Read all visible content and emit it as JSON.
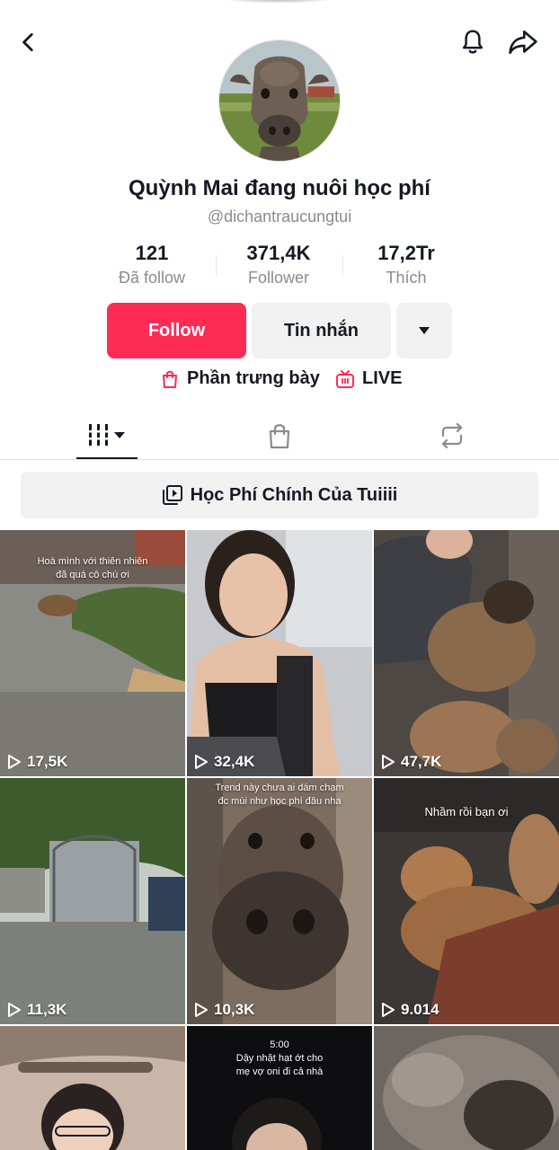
{
  "profile": {
    "display_name": "Quỳnh Mai đang nuôi học phí",
    "username": "@dichantraucungtui"
  },
  "stats": {
    "following_count": "121",
    "following_label": "Đã follow",
    "followers_count": "371,4K",
    "followers_label": "Follower",
    "likes_count": "17,2Tr",
    "likes_label": "Thích"
  },
  "actions": {
    "follow_label": "Follow",
    "message_label": "Tin nhắn"
  },
  "links": {
    "showcase_label": "Phần trưng bày",
    "live_label": "LIVE"
  },
  "playlist": {
    "title": "Học Phí Chính Của Tuiiii"
  },
  "videos": [
    {
      "views": "17,5K",
      "caption": "Hoà mình với thiên nhiên\nđã quá cô chú ơi"
    },
    {
      "views": "32,4K",
      "caption": ""
    },
    {
      "views": "47,7K",
      "caption": ""
    },
    {
      "views": "11,3K",
      "caption": ""
    },
    {
      "views": "10,3K",
      "caption": "Trend này chưa ai dám chạm\nđc mùi như học phí đâu nha"
    },
    {
      "views": "9.014",
      "caption": "Nhầm rồi bạn ơi"
    },
    {
      "views": "",
      "caption": ""
    },
    {
      "views": "",
      "caption": "5:00\nDậy nhặt hạt ớt cho\nmẹ vợ oni đi cả nhà"
    },
    {
      "views": "",
      "caption": ""
    }
  ],
  "icons": {
    "back": "chevron-left-icon",
    "notifications": "bell-icon",
    "share": "share-arrow-icon",
    "more": "caret-down-icon",
    "showcase": "shopping-bag-icon",
    "live": "live-tv-icon",
    "videos_tab": "grid-bars-icon",
    "shop_tab": "shopping-bag-icon",
    "repost_tab": "repost-icon",
    "playlist": "playlist-icon",
    "play": "play-outline-icon"
  },
  "colors": {
    "accent": "#fe2c55",
    "text_primary": "#161823",
    "text_secondary": "#8a8b91",
    "button_secondary_bg": "#f1f1f2"
  }
}
